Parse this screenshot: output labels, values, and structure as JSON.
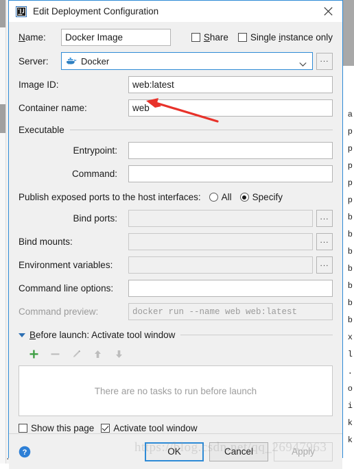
{
  "window": {
    "title": "Edit Deployment Configuration",
    "app_icon": "intellij-idea-icon",
    "close_icon": "close-icon"
  },
  "form": {
    "name_label": "Name:",
    "name_accel": "N",
    "name_value": "Docker Image",
    "share_label": "Share",
    "share_accel": "S",
    "share_checked": false,
    "single_instance_label": "Single instance only",
    "single_instance_accel": "i",
    "single_instance_checked": false,
    "server_label": "Server:",
    "server_value": "Docker",
    "server_icon": "docker-whale-icon",
    "server_browse_label": "...",
    "image_id_label": "Image ID:",
    "image_id_value": "web:latest",
    "container_name_label": "Container name:",
    "container_name_value": "web"
  },
  "executable": {
    "section_title": "Executable",
    "entrypoint_label": "Entrypoint:",
    "entrypoint_value": "",
    "command_label": "Command:",
    "command_value": ""
  },
  "ports": {
    "publish_label": "Publish exposed ports to the host interfaces:",
    "all_label": "All",
    "specify_label": "Specify",
    "selected": "Specify"
  },
  "advanced": {
    "bind_ports_label": "Bind ports:",
    "bind_ports_value": "",
    "bind_mounts_label": "Bind mounts:",
    "bind_mounts_value": "",
    "env_vars_label": "Environment variables:",
    "env_vars_value": "",
    "cmd_options_label": "Command line options:",
    "cmd_options_value": "",
    "cmd_preview_label": "Command preview:",
    "cmd_preview_value": "docker run --name web web:latest",
    "browse_label": "..."
  },
  "before_launch": {
    "header": "Before launch: Activate tool window",
    "header_accel": "B",
    "expanded": true,
    "toolbar": [
      {
        "name": "add-task-button",
        "glyph": "+",
        "enabled": true
      },
      {
        "name": "remove-task-button",
        "glyph": "−",
        "enabled": false
      },
      {
        "name": "edit-task-button",
        "glyph": "pencil",
        "enabled": false
      },
      {
        "name": "move-up-button",
        "glyph": "arrow-up",
        "enabled": false
      },
      {
        "name": "move-down-button",
        "glyph": "arrow-down",
        "enabled": false
      }
    ],
    "empty_text": "There are no tasks to run before launch",
    "show_page_label": "Show this page",
    "show_page_checked": false,
    "activate_tool_window_label": "Activate tool window",
    "activate_tool_window_checked": true
  },
  "footer": {
    "help_icon": "help-icon",
    "ok_label": "OK",
    "cancel_label": "Cancel",
    "apply_label": "Apply",
    "apply_enabled": false
  },
  "annotation": {
    "arrow": "red-arrow-pointing-to-container-name",
    "color": "#e8322a"
  },
  "watermark": {
    "text": "https://blog.csdn.net/qq_26947963"
  },
  "background": {
    "right_code_chars": [
      "a",
      "p",
      "p",
      "p",
      "p",
      "p",
      "b",
      "b",
      "b",
      "b",
      "b",
      "b",
      "b",
      "x",
      "l",
      ".",
      "o",
      "i",
      "k",
      "k"
    ],
    "bottom_code": "        ..  ..  ........   ....   ................"
  },
  "colors": {
    "accent": "#2d8ad6",
    "dialog_bg": "#f0f0f0",
    "field_bg": "#ffffff",
    "annotation_red": "#e8322a",
    "add_green": "#4caf50"
  }
}
